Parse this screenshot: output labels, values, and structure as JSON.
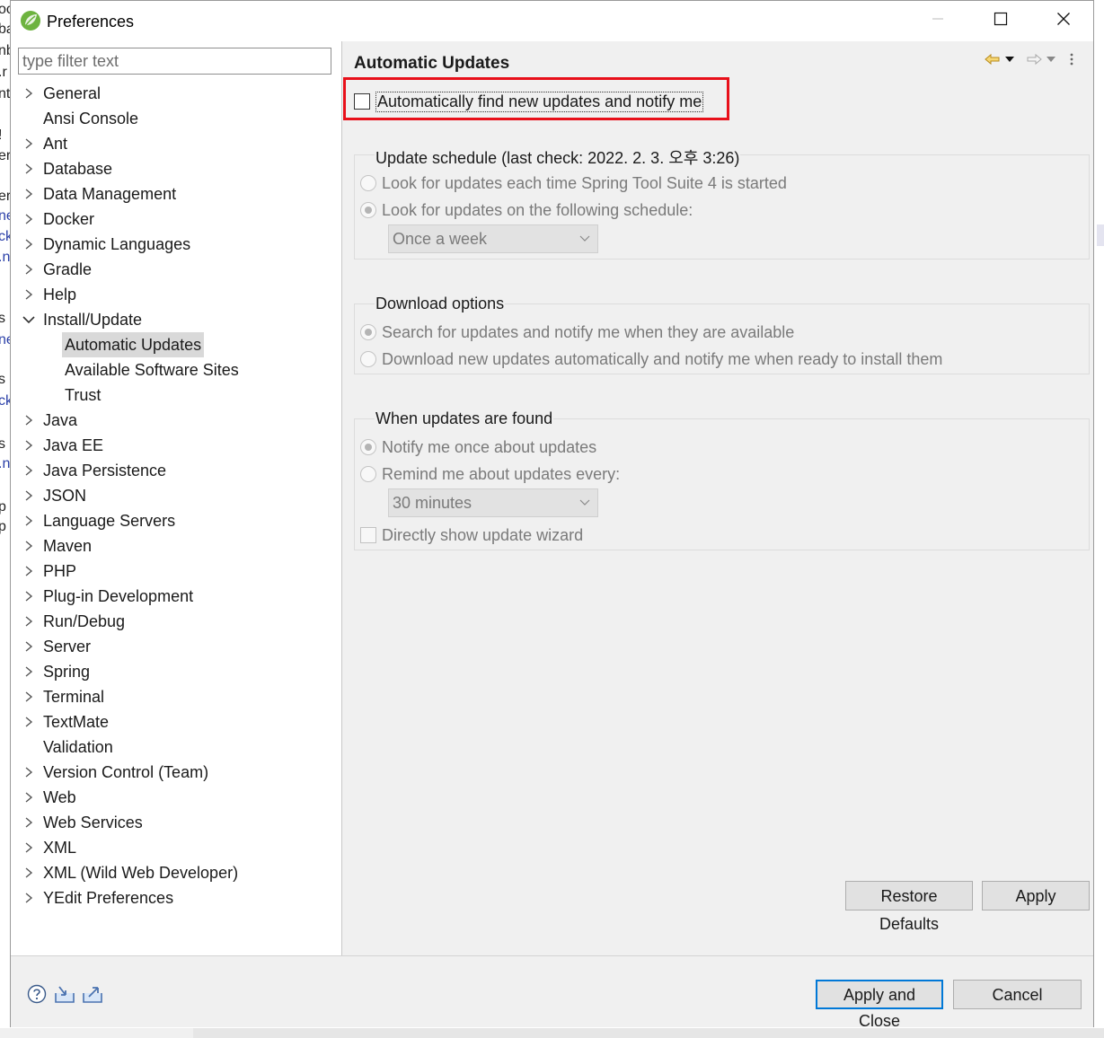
{
  "window": {
    "title": "Preferences",
    "controls": [
      "minimize-icon",
      "maximize-icon",
      "close-icon"
    ]
  },
  "filter": {
    "placeholder": "type filter text",
    "value": ""
  },
  "tree": {
    "items": [
      {
        "label": "General",
        "expandable": true
      },
      {
        "label": "Ansi Console",
        "expandable": false
      },
      {
        "label": "Ant",
        "expandable": true
      },
      {
        "label": "Database",
        "expandable": true
      },
      {
        "label": "Data Management",
        "expandable": true
      },
      {
        "label": "Docker",
        "expandable": true
      },
      {
        "label": "Dynamic Languages",
        "expandable": true
      },
      {
        "label": "Gradle",
        "expandable": true
      },
      {
        "label": "Help",
        "expandable": true
      },
      {
        "label": "Install/Update",
        "expandable": true,
        "expanded": true,
        "children": [
          "Automatic Updates",
          "Available Software Sites",
          "Trust"
        ]
      },
      {
        "label": "Java",
        "expandable": true
      },
      {
        "label": "Java EE",
        "expandable": true
      },
      {
        "label": "Java Persistence",
        "expandable": true
      },
      {
        "label": "JSON",
        "expandable": true
      },
      {
        "label": "Language Servers",
        "expandable": true
      },
      {
        "label": "Maven",
        "expandable": true
      },
      {
        "label": "PHP",
        "expandable": true
      },
      {
        "label": "Plug-in Development",
        "expandable": true
      },
      {
        "label": "Run/Debug",
        "expandable": true
      },
      {
        "label": "Server",
        "expandable": true
      },
      {
        "label": "Spring",
        "expandable": true
      },
      {
        "label": "Terminal",
        "expandable": true
      },
      {
        "label": "TextMate",
        "expandable": true
      },
      {
        "label": "Validation",
        "expandable": false
      },
      {
        "label": "Version Control (Team)",
        "expandable": true
      },
      {
        "label": "Web",
        "expandable": true
      },
      {
        "label": "Web Services",
        "expandable": true
      },
      {
        "label": "XML",
        "expandable": true
      },
      {
        "label": "XML (Wild Web Developer)",
        "expandable": true
      },
      {
        "label": "YEdit Preferences",
        "expandable": true
      }
    ],
    "selected": "Automatic Updates"
  },
  "page": {
    "title": "Automatic Updates",
    "auto_find": {
      "label": "Automatically find new updates and notify me",
      "checked": false
    },
    "schedule": {
      "title": "Update schedule (last check: 2022. 2. 3. 오후 3:26)",
      "option_startup": "Look for updates each time Spring Tool Suite 4 is started",
      "option_schedule": "Look for updates on the following schedule:",
      "selected": "schedule",
      "frequency": "Once a week"
    },
    "download": {
      "title": "Download options",
      "option_notify": "Search for updates and notify me when they are available",
      "option_auto": "Download new updates automatically and notify me when ready to install them",
      "selected": "notify"
    },
    "found": {
      "title": "When updates are found",
      "option_once": "Notify me once about updates",
      "option_remind": "Remind me about updates every:",
      "selected": "once",
      "interval": "30 minutes",
      "wizard_label": "Directly show update wizard",
      "wizard_checked": false
    }
  },
  "buttons": {
    "restore_defaults": "Restore Defaults",
    "apply": "Apply",
    "apply_and_close": "Apply and Close",
    "cancel": "Cancel"
  },
  "footer_icons": [
    "help-icon",
    "import-icon",
    "export-icon"
  ],
  "colors": {
    "highlight": "#e8101a",
    "default_button_border": "#0078d7",
    "dialog_bg": "#f0f0f0",
    "selection": "#d9d9d9"
  }
}
